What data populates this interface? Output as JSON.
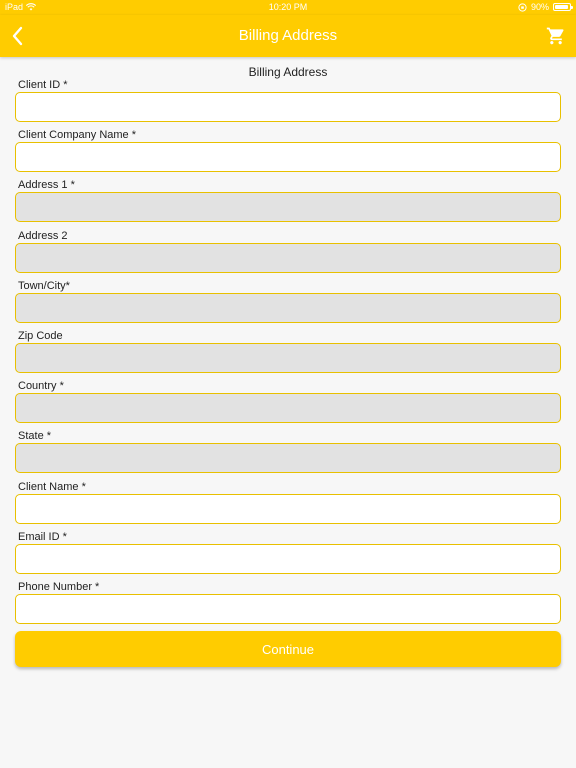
{
  "status_bar": {
    "carrier": "iPad",
    "time": "10:20 PM",
    "battery": "90%"
  },
  "nav": {
    "title": "Billing Address",
    "back_icon": "chevron-left-icon",
    "cart_icon": "cart-icon"
  },
  "form": {
    "section_title": "Billing Address",
    "fields": [
      {
        "label": "Client ID *",
        "value": "",
        "enabled": true
      },
      {
        "label": "Client Company Name *",
        "value": "",
        "enabled": true
      },
      {
        "label": "Address 1 *",
        "value": "",
        "enabled": false
      },
      {
        "label": "Address 2",
        "value": "",
        "enabled": false
      },
      {
        "label": "Town/City*",
        "value": "",
        "enabled": false
      },
      {
        "label": "Zip Code",
        "value": "",
        "enabled": false
      },
      {
        "label": "Country *",
        "value": "",
        "enabled": false
      },
      {
        "label": "State *",
        "value": "",
        "enabled": false
      },
      {
        "label": "Client Name *",
        "value": "",
        "enabled": true
      },
      {
        "label": "Email ID *",
        "value": "",
        "enabled": true
      },
      {
        "label": "Phone Number *",
        "value": "",
        "enabled": true
      }
    ],
    "continue_label": "Continue"
  },
  "colors": {
    "accent": "#ffcc00",
    "field_border": "#e8c000",
    "disabled_field": "#e2e2e2",
    "background": "#f7f7f7"
  }
}
